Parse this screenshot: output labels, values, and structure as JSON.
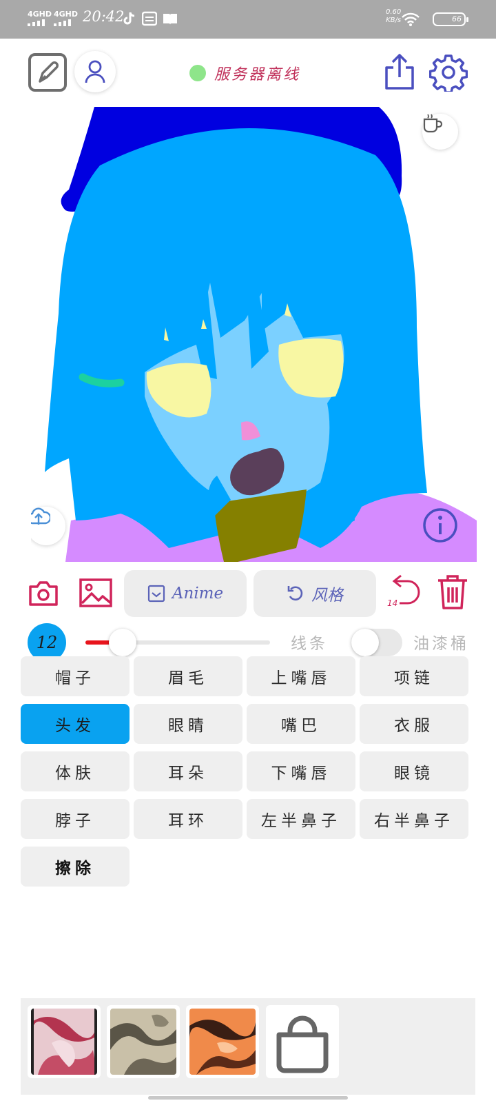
{
  "status_bar": {
    "network_1": "4GHD",
    "network_2": "4GHD",
    "time": "20:42",
    "speed_value": "0.60",
    "speed_unit": "KB/s",
    "battery": "66"
  },
  "header": {
    "edit_icon": "edit-pencil-icon",
    "profile_icon": "user-icon",
    "server_status_text": "服务器离线",
    "server_status_color": "#8ee58a",
    "share_icon": "share-icon",
    "settings_icon": "gear-icon",
    "accent_color": "#4a4fbf"
  },
  "canvas": {
    "coffee_icon": "coffee-cup-icon",
    "upload_icon": "cloud-upload-icon",
    "info_icon": "info-icon"
  },
  "tools": {
    "camera_icon": "camera-icon",
    "gallery_icon": "image-icon",
    "anime_label": "Anime",
    "style_label": "风格",
    "undo_count": "14",
    "delete_icon": "trash-icon",
    "danger_color": "#d0245a"
  },
  "brush": {
    "size": "12",
    "slider_fraction": 0.17,
    "mode_line": "线条",
    "mode_fill": "油漆桶",
    "fill_mode_on": false
  },
  "parts": {
    "items": [
      {
        "label": "帽子",
        "active": false
      },
      {
        "label": "眉毛",
        "active": false
      },
      {
        "label": "上嘴唇",
        "active": false
      },
      {
        "label": "项链",
        "active": false
      },
      {
        "label": "头发",
        "active": true
      },
      {
        "label": "眼睛",
        "active": false
      },
      {
        "label": "嘴巴",
        "active": false
      },
      {
        "label": "衣服",
        "active": false
      },
      {
        "label": "体肤",
        "active": false
      },
      {
        "label": "耳朵",
        "active": false
      },
      {
        "label": "下嘴唇",
        "active": false
      },
      {
        "label": "眼镜",
        "active": false
      },
      {
        "label": "脖子",
        "active": false
      },
      {
        "label": "耳环",
        "active": false
      },
      {
        "label": "左半鼻子",
        "active": false
      },
      {
        "label": "右半鼻子",
        "active": false
      },
      {
        "label": "擦除",
        "active": false
      }
    ]
  },
  "styles": {
    "items": [
      "style-thumb-pink",
      "style-thumb-sepia",
      "style-thumb-orange"
    ],
    "shop_icon": "shopping-bag-icon"
  }
}
